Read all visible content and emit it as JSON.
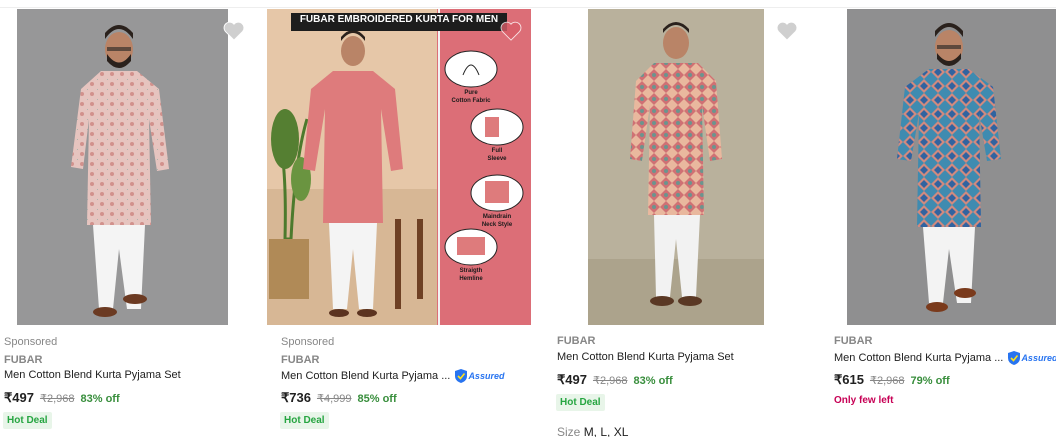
{
  "colors": {
    "price_off": "#388e3c",
    "hot_deal_text": "#26a541",
    "hot_deal_bg": "#e8f5e9",
    "few_left": "#c70055",
    "assured_blue": "#2874f0",
    "muted": "#878787"
  },
  "products": [
    {
      "sponsored": "Sponsored",
      "brand": "FUBAR",
      "title": "Men Cotton Blend Kurta Pyjama Set",
      "assured": false,
      "price": "₹497",
      "mrp": "₹2,968",
      "off": "83% off",
      "badge": "Hot Deal",
      "wishlist_icon": "heart-icon"
    },
    {
      "sponsored": "Sponsored",
      "brand": "FUBAR",
      "title": "Men Cotton Blend Kurta Pyjama ...",
      "assured": true,
      "assured_label": "Assured",
      "price": "₹736",
      "mrp": "₹4,999",
      "off": "85% off",
      "badge": "Hot Deal",
      "wishlist_icon": "heart-icon",
      "banner": {
        "heading": "FUBAR EMBROIDERED KURTA FOR MEN",
        "features": [
          {
            "line1": "Pure",
            "line2": "Cotton Fabric"
          },
          {
            "line1": "Full",
            "line2": "Sleeve"
          },
          {
            "line1": "Maindrain",
            "line2": "Neck Style"
          },
          {
            "line1": "Straigth",
            "line2": "Hemline"
          }
        ]
      }
    },
    {
      "brand": "FUBAR",
      "title": "Men Cotton Blend Kurta Pyjama Set",
      "assured": false,
      "price": "₹497",
      "mrp": "₹2,968",
      "off": "83% off",
      "badge": "Hot Deal",
      "size_label": "Size",
      "sizes": "M, L, XL",
      "wishlist_icon": "heart-icon"
    },
    {
      "brand": "FUBAR",
      "title": "Men Cotton Blend Kurta Pyjama ...",
      "assured": true,
      "assured_label": "Assured",
      "price": "₹615",
      "mrp": "₹2,968",
      "off": "79% off",
      "stock_note": "Only few left",
      "wishlist_icon": "heart-icon"
    }
  ]
}
